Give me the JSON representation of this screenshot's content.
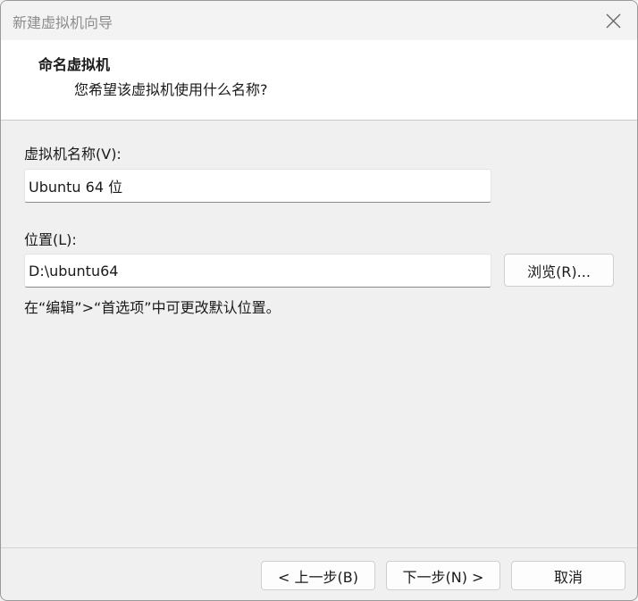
{
  "window": {
    "title": "新建虚拟机向导",
    "close_icon": "close-icon"
  },
  "header": {
    "title": "命名虚拟机",
    "subtitle": "您希望该虚拟机使用什么名称?"
  },
  "form": {
    "name_label": "虚拟机名称(V):",
    "name_value": "Ubuntu 64 位",
    "location_label": "位置(L):",
    "location_value": "D:\\ubuntu64",
    "browse_label": "浏览(R)...",
    "hint": "在“编辑”>“首选项”中可更改默认位置。"
  },
  "footer": {
    "back_label": "< 上一步(B)",
    "next_label": "下一步(N) >",
    "cancel_label": "取消"
  }
}
